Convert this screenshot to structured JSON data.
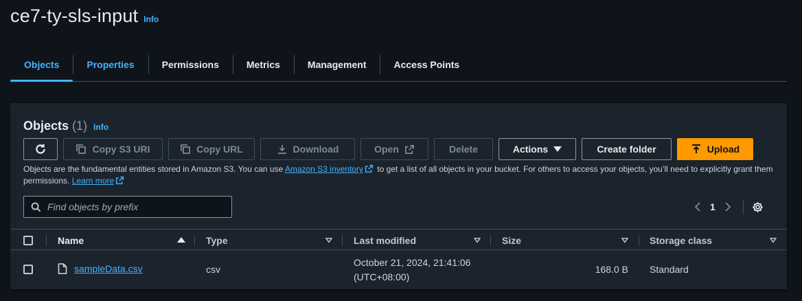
{
  "bucket": {
    "name": "ce7-ty-sls-input",
    "info_label": "Info"
  },
  "tabs": [
    {
      "label": "Objects"
    },
    {
      "label": "Properties"
    },
    {
      "label": "Permissions"
    },
    {
      "label": "Metrics"
    },
    {
      "label": "Management"
    },
    {
      "label": "Access Points"
    }
  ],
  "objects_panel": {
    "title": "Objects",
    "count": "(1)",
    "info_label": "Info",
    "toolbar": {
      "copy_s3_uri": "Copy S3 URI",
      "copy_url": "Copy URL",
      "download": "Download",
      "open": "Open",
      "delete": "Delete",
      "actions": "Actions",
      "create_folder": "Create folder",
      "upload": "Upload"
    },
    "description": {
      "part1": "Objects are the fundamental entities stored in Amazon S3. You can use ",
      "inventory_link": "Amazon S3 inventory",
      "part2": " to get a list of all objects in your bucket. For others to access your objects, you’ll need to explicitly grant them permissions. ",
      "learn_more": "Learn more"
    },
    "search": {
      "placeholder": "Find objects by prefix",
      "value": ""
    },
    "pagination": {
      "current_page": "1"
    },
    "columns": {
      "name": "Name",
      "type": "Type",
      "last_modified": "Last modified",
      "size": "Size",
      "storage_class": "Storage class"
    },
    "rows": [
      {
        "name": "sampleData.csv",
        "type": "csv",
        "last_modified_line1": "October 21, 2024, 21:41:06",
        "last_modified_line2": "(UTC+08:00)",
        "size": "168.0 B",
        "storage_class": "Standard"
      }
    ]
  },
  "colors": {
    "accent": "#42b4ff",
    "primary_button": "#ff9900",
    "background": "#0f141a",
    "panel": "#1b232d"
  },
  "icons": [
    "refresh-icon",
    "copy-icon",
    "download-icon",
    "external-link-icon",
    "caret-down-icon",
    "upload-icon",
    "search-icon",
    "chevron-left-icon",
    "chevron-right-icon",
    "settings-icon",
    "sort-ascending-icon",
    "file-icon"
  ]
}
